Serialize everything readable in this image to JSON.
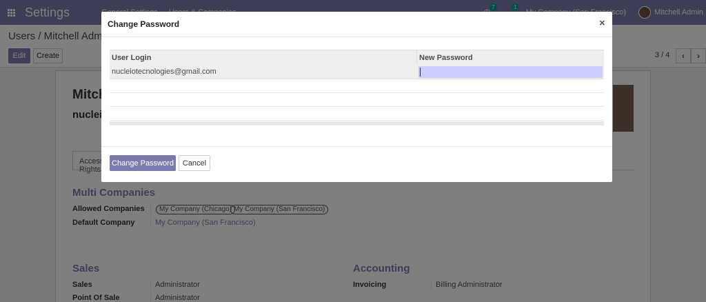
{
  "navbar": {
    "app_title": "Settings",
    "menu": [
      "General Settings",
      "Users & Companies"
    ],
    "activity_count": "7",
    "message_count": "1",
    "company": "My Company (San Francisco)",
    "user": "Mitchell Admin",
    "icons": {
      "apps": "apps-grid-icon",
      "activity": "clock-icon",
      "messages": "chat-icon"
    }
  },
  "control_panel": {
    "breadcrumb": "Users / Mitchell Admin",
    "edit_label": "Edit",
    "create_label": "Create",
    "pager": "3 / 4",
    "prev": "‹",
    "next": "›"
  },
  "form": {
    "name": "Mitchell Admin",
    "login": "nucleiotecnologies@gmail.com",
    "tab_access": "Access Rights",
    "multi_companies": {
      "title": "Multi Companies",
      "allowed_label": "Allowed Companies",
      "allowed": [
        "My Company (Chicago)",
        "My Company (San Francisco)"
      ],
      "default_label": "Default Company",
      "default_value": "My Company (San Francisco)"
    },
    "sales": {
      "title": "Sales",
      "rows": [
        {
          "label": "Sales",
          "value": "Administrator"
        },
        {
          "label": "Point Of Sale",
          "value": "Administrator"
        }
      ]
    },
    "accounting": {
      "title": "Accounting",
      "rows": [
        {
          "label": "Invoicing",
          "value": "Billing Administrator"
        }
      ]
    }
  },
  "dialog": {
    "title": "Change Password",
    "close": "×",
    "col_login": "User Login",
    "col_password": "New Password",
    "row_login": "nucleiotecnologies@gmail.com",
    "row_password": "",
    "confirm_label": "Change Password",
    "cancel_label": "Cancel"
  },
  "colors": {
    "brand": "#7c7bad",
    "input_highlight": "#ccccff"
  }
}
